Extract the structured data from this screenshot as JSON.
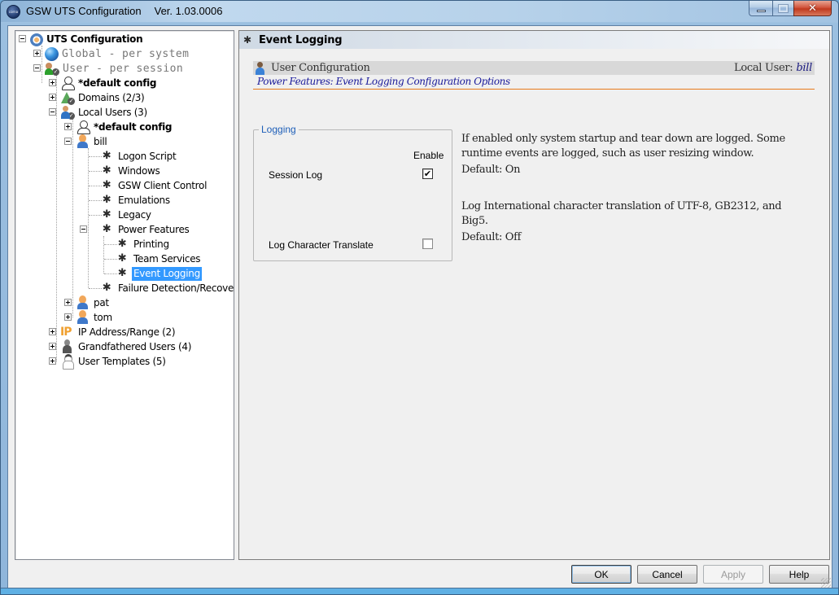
{
  "window": {
    "title": "GSW UTS Configuration",
    "version": "Ver. 1.03.0006",
    "app_icon_text": "corna",
    "controls": {
      "minimize": "minimize",
      "maximize": "maximize",
      "close": "✕"
    }
  },
  "tree": {
    "root": {
      "label": "UTS Configuration",
      "icon": "uts-gear-icon"
    },
    "global": {
      "label": "Global - per system",
      "icon": "globe-icon"
    },
    "user": {
      "label": "User  - per session",
      "icon": "users-icon"
    },
    "default_config": {
      "label": "*default config",
      "icon": "user-outline-icon"
    },
    "domains": {
      "label": "Domains (2/3)",
      "icon": "domain-icon"
    },
    "local_users": {
      "label": "Local Users (3)",
      "icon": "local-user-icon"
    },
    "lu_default_config": {
      "label": "*default config",
      "icon": "user-outline-icon"
    },
    "bill": {
      "label": "bill",
      "icon": "person-icon"
    },
    "bill_children": [
      {
        "label": "Logon Script"
      },
      {
        "label": "Windows"
      },
      {
        "label": "GSW Client Control"
      },
      {
        "label": "Emulations"
      },
      {
        "label": "Legacy"
      },
      {
        "label": "Power Features"
      }
    ],
    "power_children": [
      {
        "label": "Printing"
      },
      {
        "label": "Team Services"
      },
      {
        "label": "Event Logging",
        "selected": true
      }
    ],
    "failure": {
      "label": "Failure Detection/Recovery"
    },
    "pat": {
      "label": "pat"
    },
    "tom": {
      "label": "tom"
    },
    "ip": {
      "label": "IP Address/Range (2)",
      "icon_text": "IP"
    },
    "grandfathered": {
      "label": "Grandfathered Users (4)"
    },
    "templates": {
      "label": "User Templates (5)"
    },
    "gear_glyph": "✱"
  },
  "panel": {
    "title": "Event Logging",
    "section_title": "User Configuration",
    "local_user_label": "Local User:",
    "local_user_name": "bill",
    "subtitle": "Power Features: Event Logging Configuration Options",
    "group": {
      "legend": "Logging",
      "enable_header": "Enable",
      "options": [
        {
          "label": "Session Log",
          "checked": true,
          "check_glyph": "✔",
          "description": "If enabled only system startup and tear down are logged. Some runtime events are logged, such as user resizing window.",
          "default": "Default: On"
        },
        {
          "label": "Log Character Translate",
          "checked": false,
          "check_glyph": "",
          "description": "Log International character translation of UTF-8, GB2312, and Big5.",
          "default": "Default: Off"
        }
      ]
    }
  },
  "buttons": {
    "ok": "OK",
    "cancel": "Cancel",
    "apply": "Apply",
    "help": "Help"
  }
}
